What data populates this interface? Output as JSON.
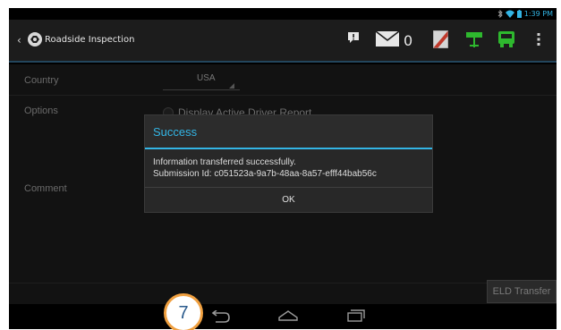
{
  "status_bar": {
    "time": "1:39 PM"
  },
  "action_bar": {
    "title": "Roadside Inspection",
    "message_count": "0"
  },
  "form": {
    "country_label": "Country",
    "country_value": "USA",
    "options_label": "Options",
    "options_radio_label": "Display Active Driver Report",
    "comment_label": "Comment"
  },
  "dialog": {
    "title": "Success",
    "message_line1": "Information transferred successfully.",
    "message_line2": "Submission Id: c051523a-9a7b-48aa-8a57-efff44bab56c",
    "ok_label": "OK"
  },
  "eld_transfer_label": "ELD Transfer",
  "step_badge": "7",
  "colors": {
    "accent": "#33b5e5",
    "icon_green": "#2eb82e",
    "badge_border": "#f0a040"
  },
  "icons": [
    "bluetooth-icon",
    "wifi-icon",
    "battery-icon",
    "alert-icon",
    "mail-icon",
    "flag-icon",
    "highway-sign-icon",
    "truck-icon",
    "overflow-menu-icon",
    "back-icon",
    "home-icon",
    "recent-apps-icon"
  ]
}
